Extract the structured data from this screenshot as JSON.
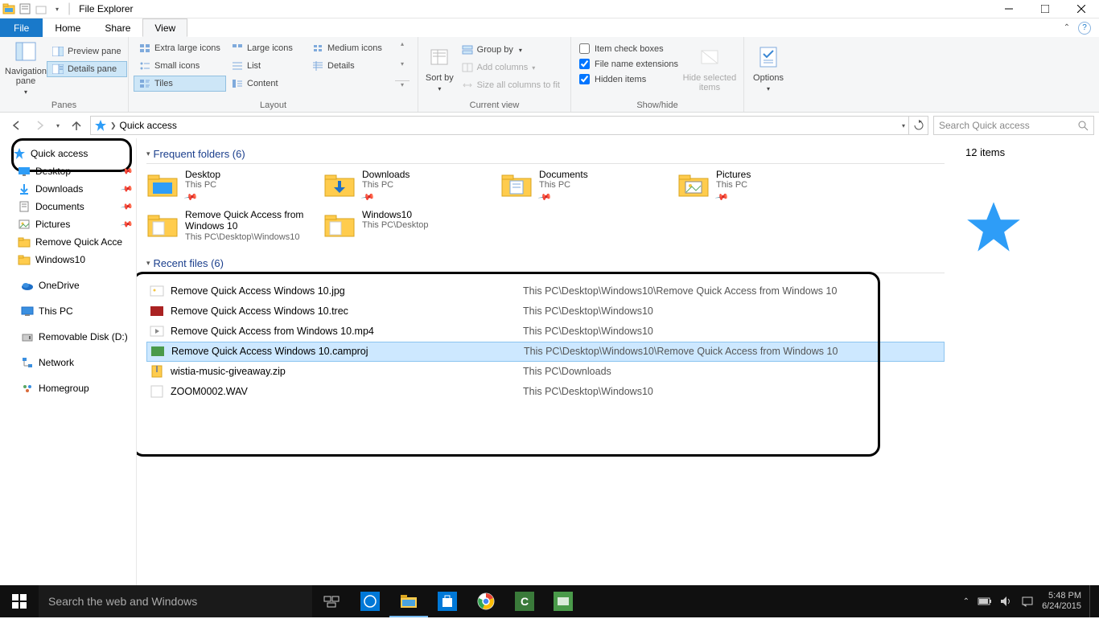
{
  "window": {
    "title": "File Explorer"
  },
  "tabs": {
    "file": "File",
    "home": "Home",
    "share": "Share",
    "view": "View"
  },
  "ribbon": {
    "panes": {
      "nav": "Navigation pane",
      "preview": "Preview pane",
      "details": "Details pane",
      "label": "Panes"
    },
    "layout": {
      "xl": "Extra large icons",
      "lg": "Large icons",
      "med": "Medium icons",
      "sm": "Small icons",
      "list": "List",
      "det": "Details",
      "tiles": "Tiles",
      "content": "Content",
      "label": "Layout"
    },
    "current": {
      "sort": "Sort by",
      "group": "Group by",
      "addcol": "Add columns",
      "size": "Size all columns to fit",
      "label": "Current view"
    },
    "showhide": {
      "itemchk": "Item check boxes",
      "ext": "File name extensions",
      "hidden": "Hidden items",
      "hidesel": "Hide selected items",
      "label": "Show/hide"
    },
    "options": "Options"
  },
  "address": {
    "location": "Quick access",
    "search_ph": "Search Quick access"
  },
  "nav": {
    "quick": "Quick access",
    "items": [
      {
        "label": "Desktop",
        "pin": true
      },
      {
        "label": "Downloads",
        "pin": true
      },
      {
        "label": "Documents",
        "pin": true
      },
      {
        "label": "Pictures",
        "pin": true
      },
      {
        "label": "Remove Quick Acce",
        "pin": false
      },
      {
        "label": "Windows10",
        "pin": false
      }
    ],
    "onedrive": "OneDrive",
    "thispc": "This PC",
    "removable": "Removable Disk (D:)",
    "network": "Network",
    "homegroup": "Homegroup"
  },
  "sections": {
    "frequent": {
      "title": "Frequent folders (6)"
    },
    "recent": {
      "title": "Recent files (6)"
    }
  },
  "folders": [
    {
      "name": "Desktop",
      "loc": "This PC",
      "pin": true,
      "icon": "desktop"
    },
    {
      "name": "Downloads",
      "loc": "This PC",
      "pin": true,
      "icon": "downloads"
    },
    {
      "name": "Documents",
      "loc": "This PC",
      "pin": true,
      "icon": "documents"
    },
    {
      "name": "Pictures",
      "loc": "This PC",
      "pin": true,
      "icon": "pictures"
    },
    {
      "name": "Remove Quick Access from Windows 10",
      "loc": "This PC\\Desktop\\Windows10",
      "pin": false,
      "icon": "folder"
    },
    {
      "name": "Windows10",
      "loc": "This PC\\Desktop",
      "pin": false,
      "icon": "folder"
    }
  ],
  "files": [
    {
      "name": "Remove Quick Access Windows 10.jpg",
      "path": "This PC\\Desktop\\Windows10\\Remove Quick Access from Windows 10",
      "sel": false,
      "ic": "img"
    },
    {
      "name": "Remove Quick Access Windows 10.trec",
      "path": "This PC\\Desktop\\Windows10",
      "sel": false,
      "ic": "rec"
    },
    {
      "name": "Remove Quick Access from Windows 10.mp4",
      "path": "This PC\\Desktop\\Windows10",
      "sel": false,
      "ic": "vid"
    },
    {
      "name": "Remove Quick Access Windows 10.camproj",
      "path": "This PC\\Desktop\\Windows10\\Remove Quick Access from Windows 10",
      "sel": true,
      "ic": "proj"
    },
    {
      "name": "wistia-music-giveaway.zip",
      "path": "This PC\\Downloads",
      "sel": false,
      "ic": "zip"
    },
    {
      "name": "ZOOM0002.WAV",
      "path": "This PC\\Desktop\\Windows10",
      "sel": false,
      "ic": "wav"
    }
  ],
  "details": {
    "count": "12 items"
  },
  "status": {
    "text": "12 items"
  },
  "taskbar": {
    "search_ph": "Search the web and Windows",
    "time": "5:48 PM",
    "date": "6/24/2015"
  }
}
